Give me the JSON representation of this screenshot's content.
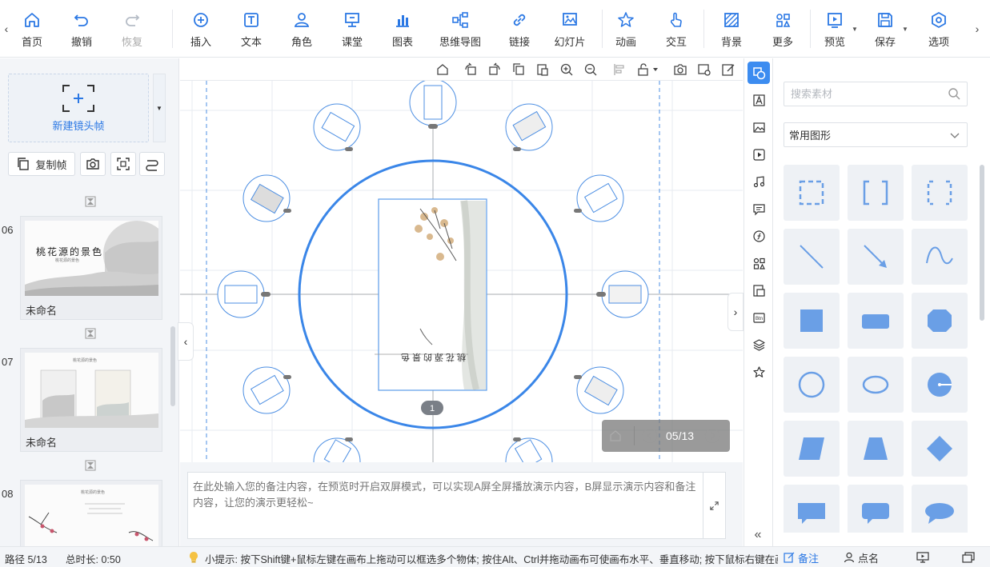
{
  "toolbar": {
    "items": [
      {
        "label": "首页",
        "icon": "home-icon"
      },
      {
        "label": "撤销",
        "icon": "undo-icon"
      },
      {
        "label": "恢复",
        "icon": "redo-icon"
      },
      {
        "label": "插入",
        "icon": "plus-circle-icon"
      },
      {
        "label": "文本",
        "icon": "text-icon"
      },
      {
        "label": "角色",
        "icon": "person-icon"
      },
      {
        "label": "课堂",
        "icon": "classroom-icon"
      },
      {
        "label": "图表",
        "icon": "bar-chart-icon"
      },
      {
        "label": "思维导图",
        "icon": "mindmap-icon"
      },
      {
        "label": "链接",
        "icon": "link-icon"
      },
      {
        "label": "幻灯片",
        "icon": "slides-icon"
      },
      {
        "label": "动画",
        "icon": "star-animation-icon"
      },
      {
        "label": "交互",
        "icon": "hand-pointer-icon"
      },
      {
        "label": "背景",
        "icon": "background-icon"
      },
      {
        "label": "更多",
        "icon": "more-grid-icon"
      },
      {
        "label": "预览",
        "icon": "play-preview-icon"
      },
      {
        "label": "保存",
        "icon": "save-icon"
      },
      {
        "label": "选项",
        "icon": "hexagon-settings-icon"
      }
    ],
    "accent": "#2b78e4"
  },
  "left_panel": {
    "new_frame_label": "新建镜头帧",
    "copy_frame_label": "复制帧",
    "slides": [
      {
        "num": "06",
        "name": "未命名",
        "thumb_title": "桃花源的景色",
        "thumb_sub": "桃花源的景色"
      },
      {
        "num": "07",
        "name": "未命名",
        "thumb_title": "桃花源的景色"
      },
      {
        "num": "08",
        "name": "",
        "thumb_title": "桃花源的景色"
      }
    ]
  },
  "canvas": {
    "frame_badge": "1",
    "counter": "05/13",
    "center_text": "桃花源的景色"
  },
  "notes": {
    "placeholder": "在此处输入您的备注内容，在预览时开启双屏模式，可以实现A屏全屏播放演示内容，B屏显示演示内容和备注内容，让您的演示更轻松~"
  },
  "right_panel": {
    "search_placeholder": "搜索素材",
    "category": "常用图形",
    "shape_fill": "#6a9fe6",
    "shape_bg": "#eef1f5"
  },
  "status": {
    "path": "路径 5/13",
    "duration": "总时长: 0:50",
    "tip": "小提示: 按下Shift键+鼠标左键在画布上拖动可以框选多个物体; 按住Alt、Ctrl并拖动画布可使画布水平、垂直移动; 按下鼠标右键在画布",
    "notes_btn": "备注",
    "rollcall_btn": "点名"
  }
}
